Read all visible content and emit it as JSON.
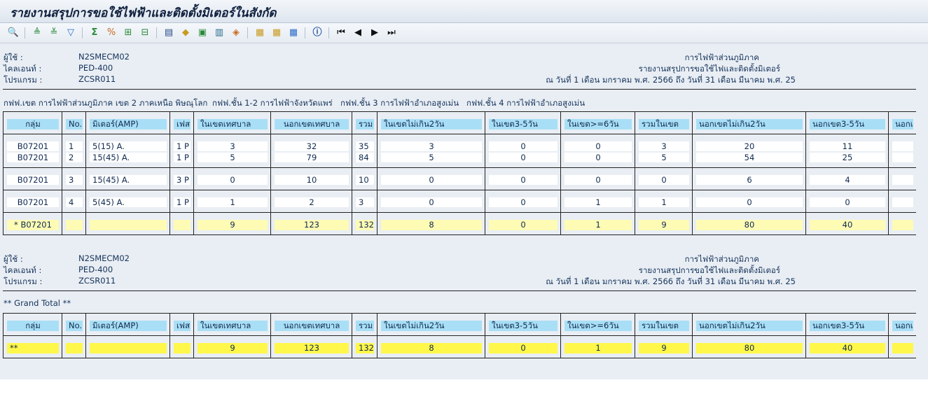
{
  "title": "รายงานสรุปการขอใช้ไฟฟ้าและติดตั้งมิเตอร์ในสังกัด",
  "toolbar_icons": [
    "detail-icon",
    "sort-asc-icon",
    "sort-desc-icon",
    "filter-icon",
    "sum-icon",
    "subtotal-icon",
    "add-column-icon",
    "delete-column-icon",
    "export-icon",
    "print-icon",
    "save-icon",
    "layout-icon",
    "find-icon",
    "grid-icon",
    "change-layout-icon",
    "select-layout-icon",
    "info-icon",
    "first-page-icon",
    "prev-page-icon",
    "next-page-icon",
    "last-page-icon"
  ],
  "header_block": {
    "user_label": "ผู้ใช้    :",
    "user_value": "N2SMECM02",
    "client_label": "ไคลเอนท์  :",
    "client_value": "PED-400",
    "program_label": "โปรแกรม   :",
    "program_value": "ZCSR011",
    "org": "การไฟฟ้าส่วนภูมิภาค",
    "report_name": "รายงานสรุปการขอใช้ไฟและติดตั้งมิเตอร์",
    "date_range": "ณ วันที่ 1 เดือน มกราคม พ.ศ. 2566 ถึง วันที่ 31 เดือน มีนาคม พ.ศ. 25"
  },
  "groups": [
    "กฟฟ.เขต การไฟฟ้าส่วนภูมิภาค เขต 2 ภาคเหนือ พิษณุโลก",
    "กฟฟ.ชั้น 1-2 การไฟฟ้าจังหวัดแพร่",
    "กฟฟ.ชั้น 3 การไฟฟ้าอำเภอสูงเม่น",
    "กฟฟ.ชั้น 4 การไฟฟ้าอำเภอสูงเม่น"
  ],
  "columns": [
    "กลุ่ม",
    "No.",
    "มิเตอร์(AMP)",
    "เฟส",
    "ในเขตเทศบาล",
    "นอกเขตเทศบาล",
    "รวม",
    "ในเขตไม่เกิน2วัน",
    "ในเขต3-5วัน",
    "ในเขต>=6วัน",
    "รวมในเขต",
    "นอกเขตไม่เกิน2วัน",
    "นอกเขต3-5วัน",
    "นอกเ"
  ],
  "rows": [
    {
      "group": "B07201",
      "no": "1",
      "meter": "5(15) A.",
      "phase": "1 P",
      "in_muni": "3",
      "out_muni": "32",
      "total": "35",
      "in_le2": "3",
      "in_3_5": "0",
      "in_ge6": "0",
      "in_total": "3",
      "out_le2": "20",
      "out_3_5": "11"
    },
    {
      "group": "B07201",
      "no": "2",
      "meter": "15(45) A.",
      "phase": "1 P",
      "in_muni": "5",
      "out_muni": "79",
      "total": "84",
      "in_le2": "5",
      "in_3_5": "0",
      "in_ge6": "0",
      "in_total": "5",
      "out_le2": "54",
      "out_3_5": "25"
    },
    {
      "group": "B07201",
      "no": "3",
      "meter": "15(45) A.",
      "phase": "3 P",
      "in_muni": "0",
      "out_muni": "10",
      "total": "10",
      "in_le2": "0",
      "in_3_5": "0",
      "in_ge6": "0",
      "in_total": "0",
      "out_le2": "6",
      "out_3_5": "4"
    },
    {
      "group": "B07201",
      "no": "4",
      "meter": "5(45) A.",
      "phase": "1 P",
      "in_muni": "1",
      "out_muni": "2",
      "total": "3",
      "in_le2": "0",
      "in_3_5": "0",
      "in_ge6": "1",
      "in_total": "1",
      "out_le2": "0",
      "out_3_5": "0"
    }
  ],
  "subtotal": {
    "group": "*  B07201",
    "in_muni": "9",
    "out_muni": "123",
    "total": "132",
    "in_le2": "8",
    "in_3_5": "0",
    "in_ge6": "1",
    "in_total": "9",
    "out_le2": "80",
    "out_3_5": "40"
  },
  "grand_total_label": "** Grand Total **",
  "grand_total": {
    "group": "**",
    "in_muni": "9",
    "out_muni": "123",
    "total": "132",
    "in_le2": "8",
    "in_3_5": "0",
    "in_ge6": "1",
    "in_total": "9",
    "out_le2": "80",
    "out_3_5": "40"
  }
}
